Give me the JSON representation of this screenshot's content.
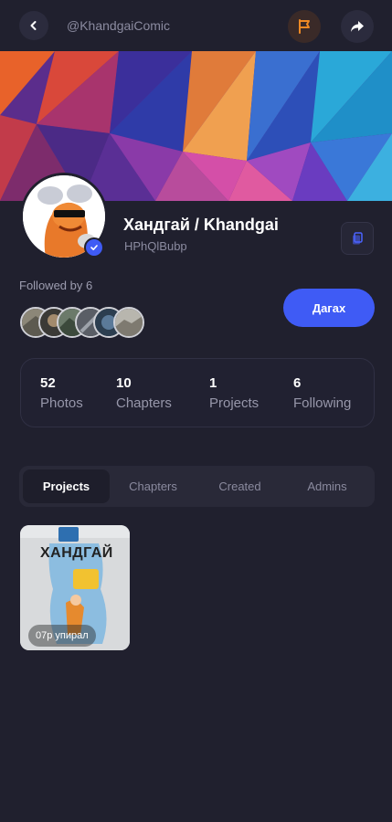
{
  "header": {
    "handle": "@KhandgaiComic",
    "back_icon": "chevron-left-icon",
    "flag_icon": "flag-icon",
    "share_icon": "share-icon",
    "flag_color": "#f08a24"
  },
  "profile": {
    "name": "Хандгай / Khandgai",
    "uid": "HPhQlBubp",
    "verified": true,
    "followed_by": "Followed by 6",
    "follow_label": "Дагах",
    "accent": "#3f5bf5"
  },
  "stats": [
    {
      "value": "52",
      "label": "Photos"
    },
    {
      "value": "10",
      "label": "Chapters"
    },
    {
      "value": "1",
      "label": "Projects"
    },
    {
      "value": "6",
      "label": "Following"
    }
  ],
  "tabs": [
    {
      "label": "Projects",
      "active": true
    },
    {
      "label": "Chapters",
      "active": false
    },
    {
      "label": "Created",
      "active": false
    },
    {
      "label": "Admins",
      "active": false
    }
  ],
  "projects": [
    {
      "cover_title": "ХАНДГАЙ",
      "views": "07р упирал"
    }
  ]
}
